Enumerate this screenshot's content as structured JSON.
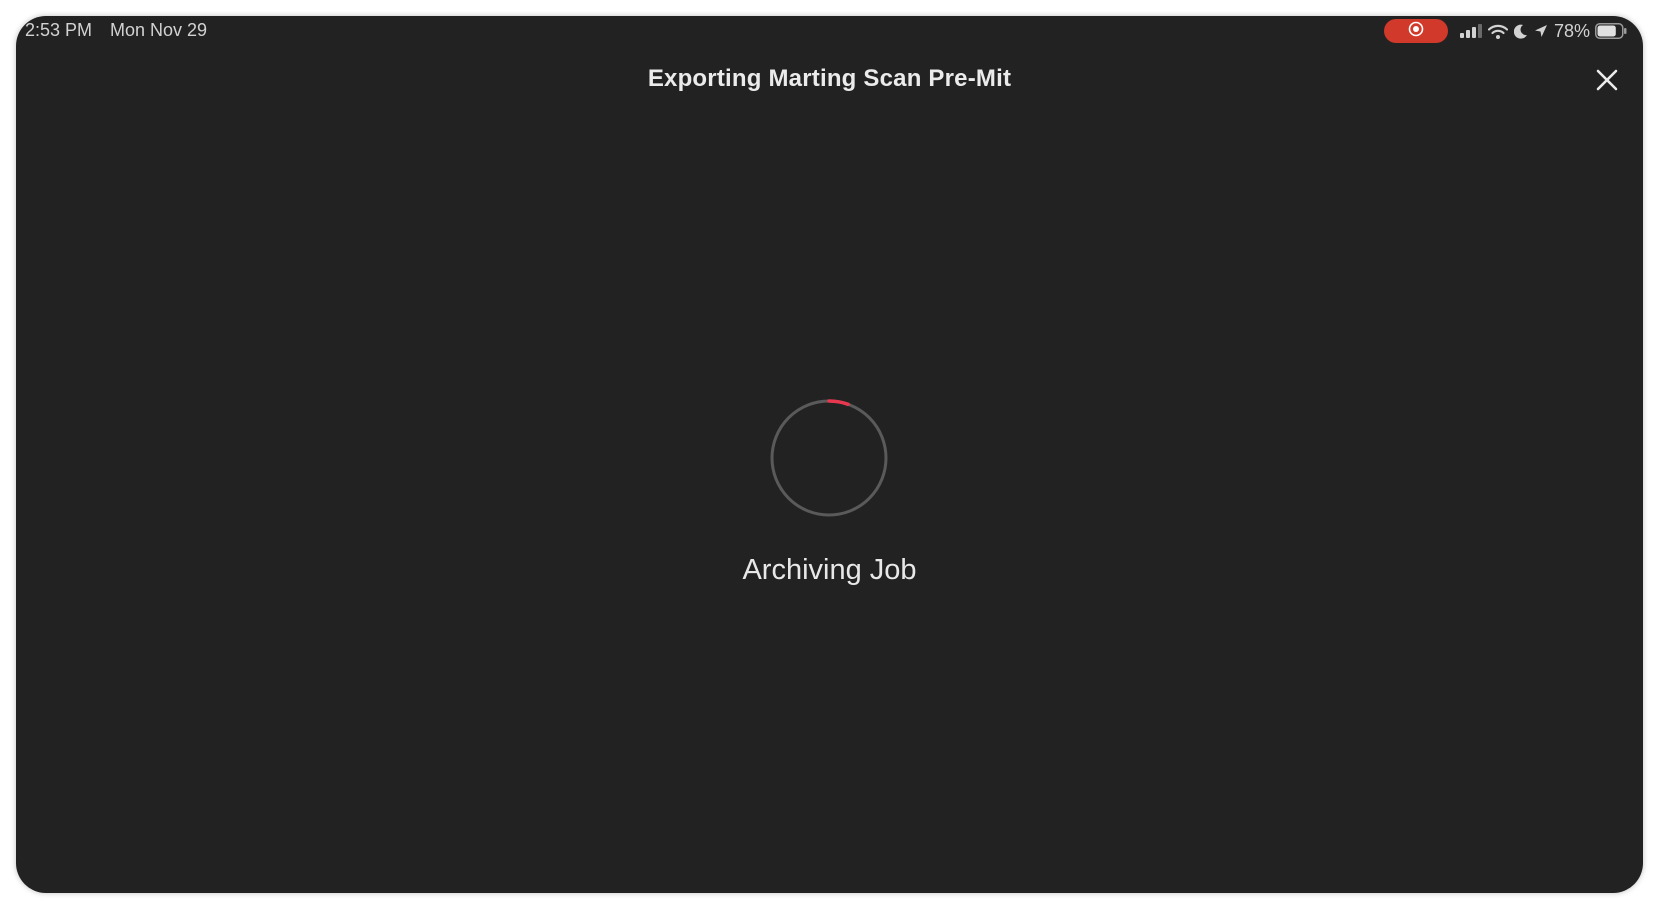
{
  "status_bar": {
    "time": "2:53 PM",
    "date": "Mon Nov 29",
    "battery_percent": "78%",
    "battery_level": 0.78,
    "icons": [
      "screen-record-icon",
      "cellular-signal-icon",
      "wifi-icon",
      "do-not-disturb-moon-icon",
      "location-arrow-icon",
      "battery-icon"
    ]
  },
  "header": {
    "title": "Exporting Marting Scan Pre-Mit",
    "close_icon": "close-icon"
  },
  "main": {
    "spinner_icon": "loading-spinner-icon",
    "status_text": "Archiving Job"
  },
  "colors": {
    "background": "#232223",
    "record_red": "#d1392b",
    "spinner_accent": "#e8384f",
    "spinner_track": "#5a5a5a",
    "text": "#e8e8e8"
  }
}
